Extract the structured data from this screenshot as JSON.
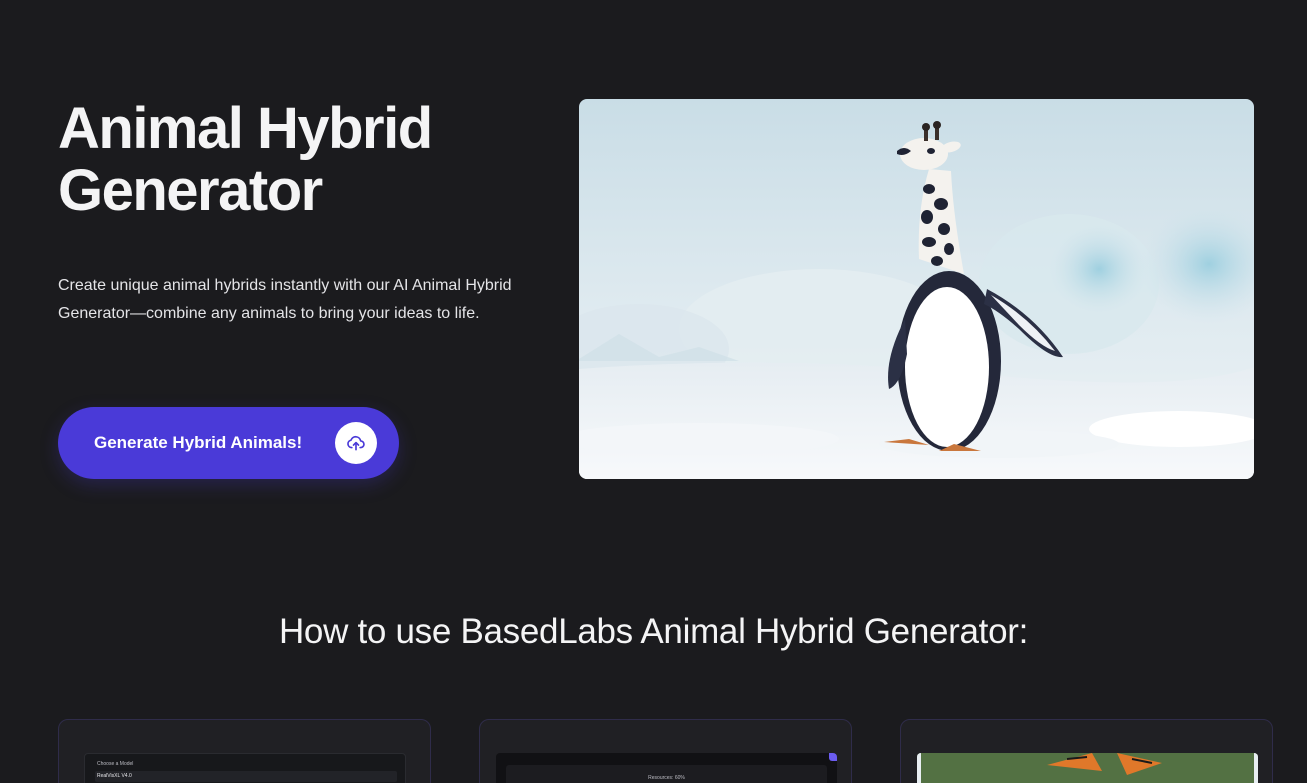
{
  "hero": {
    "title": "Animal Hybrid Generator",
    "description": "Create unique animal hybrids instantly with our AI Animal Hybrid Generator—combine any animals to bring your ideas to life.",
    "cta_label": "Generate Hybrid Animals!",
    "cta_icon": "cloud-upload-icon"
  },
  "howto": {
    "title": "How to use BasedLabs Animal Hybrid Generator:",
    "steps": [
      {
        "screenshot_heading": "Choose a Model",
        "screenshot_value": "RealVisXL V4.0"
      },
      {
        "screenshot_heading": "Resources: 60%"
      },
      {
        "screenshot_heading": ""
      }
    ]
  },
  "colors": {
    "background": "#1b1b1e",
    "accent": "#4a3ad8",
    "card_border": "#2f2c4a"
  }
}
